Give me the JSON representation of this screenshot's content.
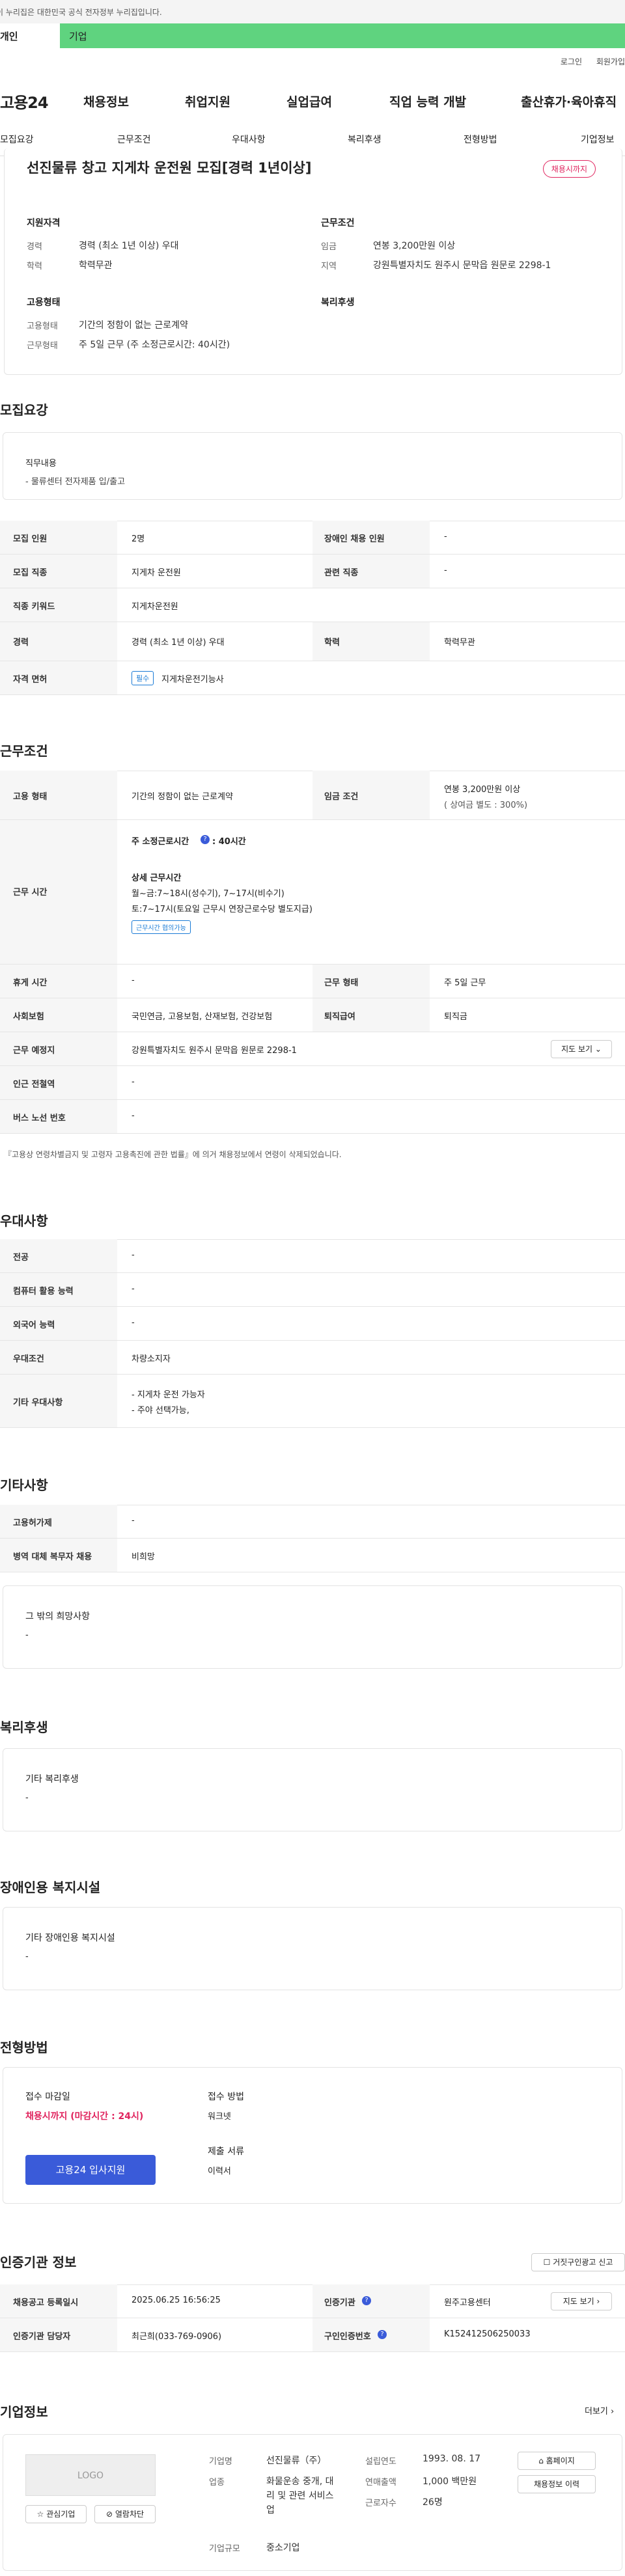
{
  "gov_notice": "이 누리집은 대한민국 공식 전자정부 누리집입니다.",
  "audience_tabs": {
    "person": "개인",
    "business": "기업"
  },
  "util_links": [
    "로그인",
    "회원가입"
  ],
  "logo": "고용24",
  "gnb": [
    "채용정보",
    "취업지원",
    "실업급여",
    "직업 능력 개발",
    "출산휴가·육아휴직"
  ],
  "subnav": [
    "모집요강",
    "근무조건",
    "우대사항",
    "복리후생",
    "전형방법",
    "기업정보"
  ],
  "summary": {
    "title": "선진물류 창고 지게차 운전원 모집[경력 1년이상]",
    "deadline_badge": "채용시까지",
    "qual_title": "지원자격",
    "qual_career_lbl": "경력",
    "qual_career_val": "경력 (최소 1년 이상) 우대",
    "qual_edu_lbl": "학력",
    "qual_edu_val": "학력무관",
    "cond_title": "근무조건",
    "cond_pay_lbl": "임금",
    "cond_pay_val": "연봉 3,200만원 이상",
    "cond_loc_lbl": "지역",
    "cond_loc_val": "강원특별자치도 원주시 문막읍 원문로 2298-1",
    "emp_title": "고용형태",
    "emp_type_lbl": "고용형태",
    "emp_type_val": "기간의 정함이 없는 근로계약",
    "emp_work_lbl": "근무형태",
    "emp_work_val": "주 5일 근무 (주 소정근로시간: 40시간)",
    "welfare_title": "복리후생"
  },
  "recruit": {
    "title": "모집요강",
    "job_lbl": "직무내용",
    "job_val": "- 물류센터 전자제품 입/출고",
    "rows": [
      {
        "k1": "모집 인원",
        "v1": "2명",
        "k2": "장애인 채용 인원",
        "v2": "-"
      },
      {
        "k1": "모집 직종",
        "v1": "지게차 운전원",
        "k2": "관련 직종",
        "v2": "-"
      },
      {
        "k1": "직종 키워드",
        "v1": "지게차운전원"
      },
      {
        "k1": "경력",
        "v1": "경력 (최소 1년 이상) 우대",
        "k2": "학력",
        "v2": "학력무관"
      },
      {
        "k1": "자격 면허",
        "badge": "필수",
        "v1": "지게차운전기능사"
      }
    ]
  },
  "work": {
    "title": "근무조건",
    "emp_lbl": "고용 형태",
    "emp_val": "기간의 정함이 없는 근로계약",
    "pay_lbl": "임금 조건",
    "pay_val": "연봉 3,200만원 이상",
    "pay_sub": "( 상여금 별도 : 300%)",
    "time_lbl": "근무 시간",
    "time_weekly": "주 소정근로시간",
    "time_weekly_val": ": 40시간",
    "time_detail_title": "상세 근무시간",
    "time_detail_1": "월~금:7~18시(성수기), 7~17시(비수기)",
    "time_detail_2": "토:7~17시(토요일 근무시 연장근로수당 별도지급)",
    "time_badge": "근무시간 협의가능",
    "rest_lbl": "휴게 시간",
    "rest_val": "-",
    "form_lbl": "근무 형태",
    "form_val": "주 5일 근무",
    "ins_lbl": "사회보험",
    "ins_val": "국민연금, 고용보험, 산재보험, 건강보험",
    "sev_lbl": "퇴직급여",
    "sev_val": "퇴직금",
    "place_lbl": "근무 예정지",
    "place_val": "강원특별자치도 원주시 문막읍 원문로 2298-1",
    "map_btn": "지도 보기",
    "subway_lbl": "인근 전철역",
    "subway_val": "-",
    "bus_lbl": "버스 노선 번호",
    "bus_val": "-",
    "note": "『고용상 연령차별금지 및 고령자 고용촉진에 관한 법률』에 의거 채용정보에서 연령이 삭제되었습니다."
  },
  "prefer": {
    "title": "우대사항",
    "rows": [
      {
        "k": "전공",
        "v": "-"
      },
      {
        "k": "컴퓨터 활용 능력",
        "v": "-"
      },
      {
        "k": "외국어 능력",
        "v": "-"
      },
      {
        "k": "우대조건",
        "v": "차량소지자"
      },
      {
        "k": "기타 우대사항",
        "v": "- 지게차 운전 가능자",
        "v2": "- 주야 선택가능,"
      }
    ]
  },
  "etc": {
    "title": "기타사항",
    "rows": [
      {
        "k": "고용허가제",
        "v": "-"
      },
      {
        "k": "병역 대체 복무자 채용",
        "v": "비희망"
      }
    ],
    "hope_lbl": "그 밖의 희망사항",
    "hope_val": "-"
  },
  "welfare": {
    "title": "복리후생",
    "lbl": "기타 복리후생",
    "val": "-"
  },
  "disabled": {
    "title": "장애인용 복지시설",
    "lbl": "기타 장애인용 복지시설",
    "val": "-"
  },
  "process": {
    "title": "전형방법",
    "deadline_lbl": "접수 마감일",
    "deadline_val": "채용시까지 (마감시간 : 24시)",
    "apply_btn": "고용24 입사지원",
    "method_lbl": "접수 방법",
    "method_val": "워크넷",
    "docs_lbl": "제출 서류",
    "docs_val": "이력서"
  },
  "agency": {
    "title": "인증기관 정보",
    "report_btn": "거짓구인광고 신고",
    "reg_lbl": "채용공고 등록일시",
    "reg_val": "2025.06.25 16:56:25",
    "org_lbl": "인증기관",
    "org_val": "원주고용센터",
    "map_btn": "지도 보기",
    "manager_lbl": "인증기관 담당자",
    "manager_val": "최근희(033-769-0906)",
    "no_lbl": "구인인증번호",
    "no_val": "K152412506250033"
  },
  "company": {
    "title": "기업정보",
    "more": "더보기",
    "logo_text": "LOGO",
    "fav_btn": "관심기업",
    "block_btn": "열람차단",
    "name_lbl": "기업명",
    "name_val": "선진물류（주）",
    "biz_lbl": "업종",
    "biz_val_1": "화물운송 중개, 대",
    "biz_val_2": "리 및 관련 서비스",
    "biz_val_3": "업",
    "size_lbl": "기업규모",
    "size_val": "중소기업",
    "year_lbl": "설립연도",
    "year_val": "1993. 08. 17",
    "sales_lbl": "연매출액",
    "sales_val": "1,000 백만원",
    "emp_lbl": "근로자수",
    "emp_val": "26명",
    "home_btn": "홈페이지",
    "list_btn": "채용정보 이력"
  },
  "colors": {
    "accent_green": "#5fd37f",
    "primary_blue": "#3a5bd9",
    "deadline_pink": "#e0245e"
  }
}
